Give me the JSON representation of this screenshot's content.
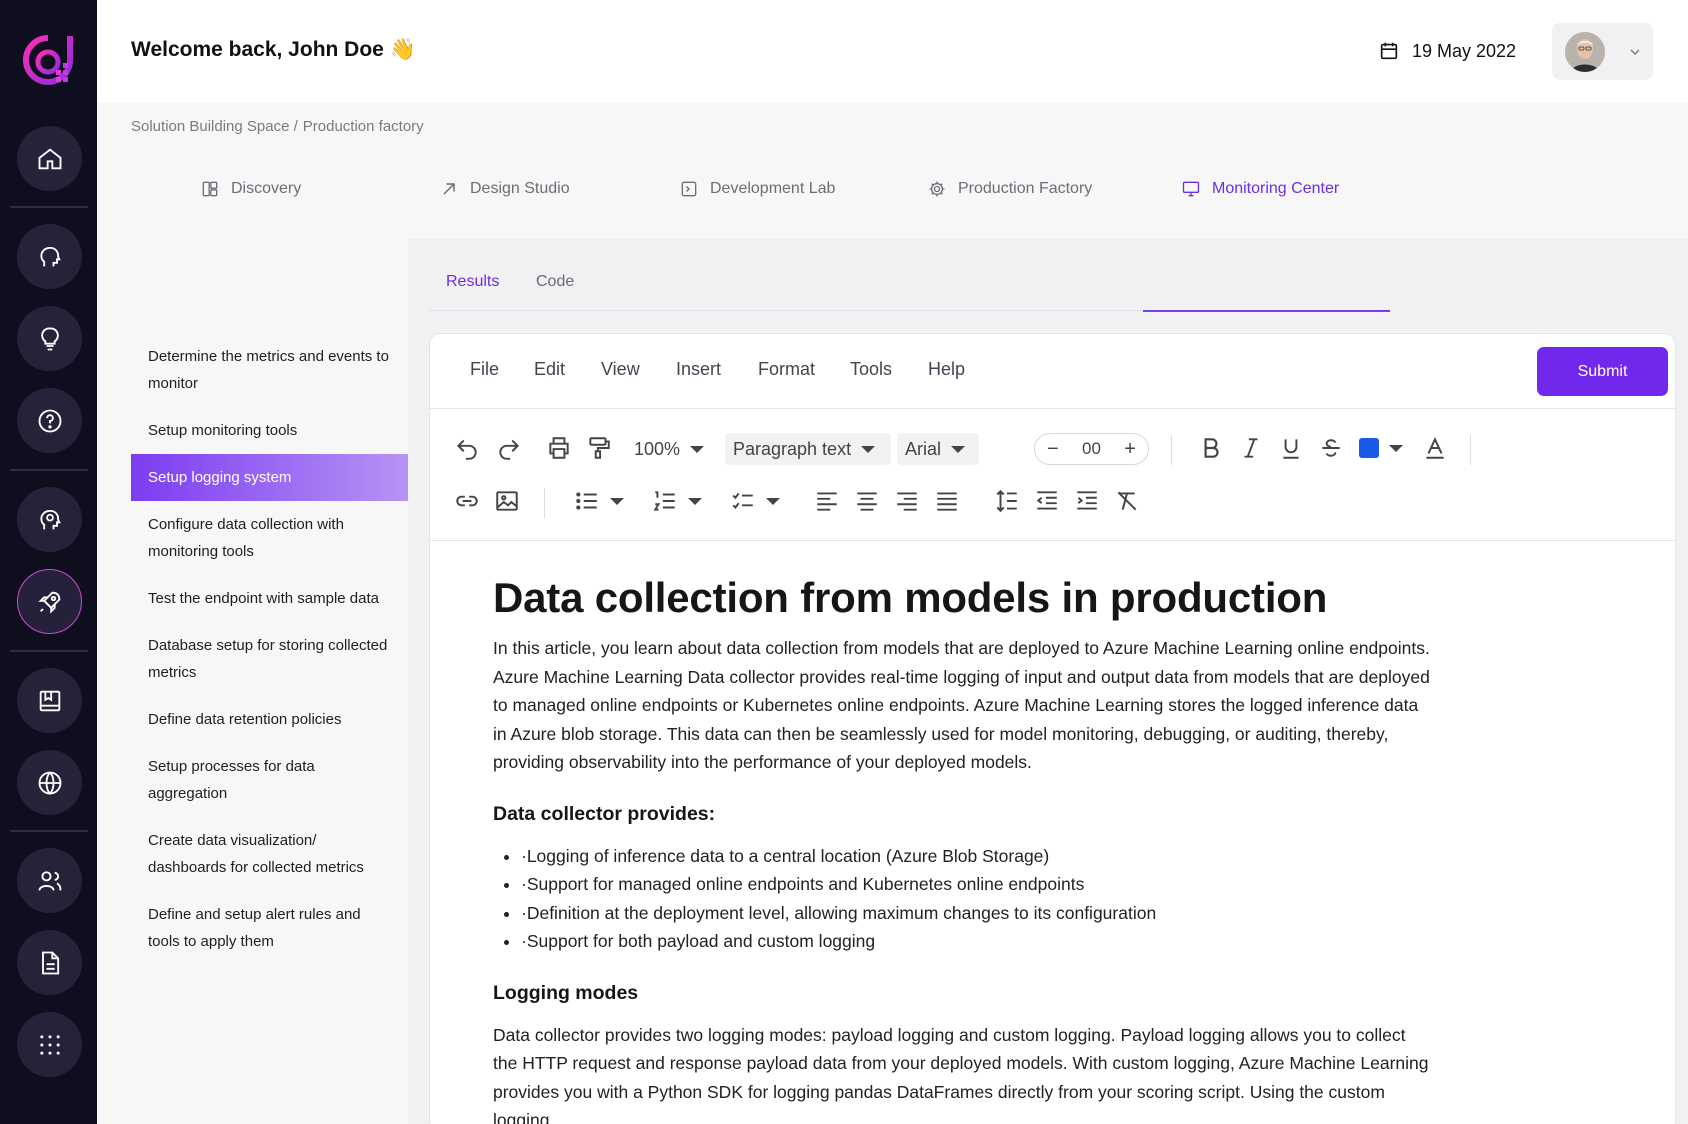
{
  "header": {
    "welcome": "Welcome back, John Doe 👋",
    "date": "19 May 2022"
  },
  "breadcrumb": {
    "items": [
      "Solution Building Space /",
      "Production factory"
    ]
  },
  "main_tabs": [
    {
      "label": "Discovery",
      "icon": "layout-icon"
    },
    {
      "label": "Design Studio",
      "icon": "arrow-up-right-icon"
    },
    {
      "label": "Development Lab",
      "icon": "terminal-icon"
    },
    {
      "label": "Production Factory",
      "icon": "gear-icon"
    },
    {
      "label": "Monitoring Center",
      "icon": "monitor-icon",
      "active": true
    }
  ],
  "steps": [
    {
      "label": "Determine the metrics and events to monitor"
    },
    {
      "label": "Setup monitoring tools"
    },
    {
      "label": "Setup logging system",
      "active": true
    },
    {
      "label": "Configure data collection with monitoring tools"
    },
    {
      "label": "Test the endpoint with sample data"
    },
    {
      "label": "Database setup for storing collected metrics"
    },
    {
      "label": "Define data retention policies"
    },
    {
      "label": "Setup processes for data aggregation"
    },
    {
      "label": "Create data visualization/ dashboards for collected metrics"
    },
    {
      "label": "Define and setup alert rules and tools to apply them"
    }
  ],
  "sub_tabs": [
    {
      "label": "Results",
      "active": true
    },
    {
      "label": "Code"
    }
  ],
  "menubar": {
    "items": [
      "File",
      "Edit",
      "View",
      "Insert",
      "Format",
      "Tools",
      "Help"
    ],
    "submit": "Submit"
  },
  "toolbar": {
    "zoom": "100%",
    "block_style": "Paragraph text",
    "font": "Arial",
    "font_size": "00",
    "text_color": "#1a5ae6"
  },
  "document": {
    "title": "Data collection from models in production",
    "intro": "In this article, you learn about data collection from models that are deployed to Azure Machine Learning online endpoints. Azure Machine Learning Data collector provides real-time logging of input and output data from models that are deployed to managed online endpoints or Kubernetes online endpoints. Azure Machine Learning stores the logged inference data in Azure blob storage. This data can then be seamlessly used for model monitoring, debugging, or auditing, thereby, providing observability into the performance of your deployed models.",
    "section1_title": "Data collector provides:",
    "section1_items": [
      "·Logging of inference data to a central location (Azure Blob Storage)",
      "·Support for managed online endpoints and Kubernetes online endpoints",
      "·Definition at the deployment level, allowing maximum changes to its configuration",
      "·Support for both payload and custom logging"
    ],
    "section2_title": "Logging modes",
    "section2_text": "Data collector provides two logging modes: payload logging and custom logging. Payload logging allows you to collect the HTTP request and response payload data from your deployed models. With custom logging, Azure Machine Learning provides you with a Python SDK for logging pandas DataFrames directly from your scoring script. Using the custom logging"
  },
  "colors": {
    "accent": "#7228ec",
    "rail_bg": "#0f0e1e",
    "brand_magenta": "#d62ad6"
  }
}
